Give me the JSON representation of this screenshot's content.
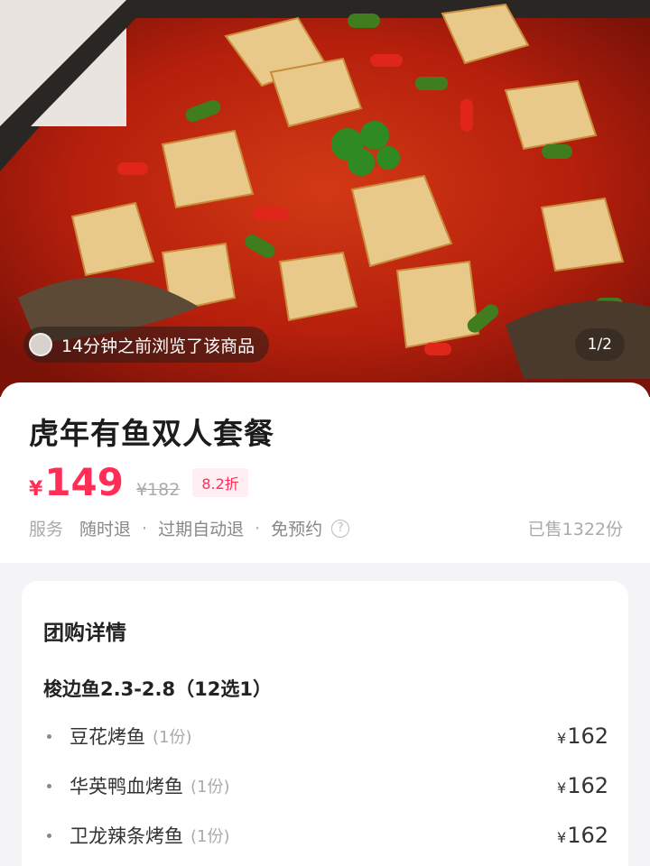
{
  "hero": {
    "image_alt": "food-photo",
    "viewed_text": "14分钟之前浏览了该商品",
    "pager": "1/2"
  },
  "product": {
    "title": "虎年有鱼双人套餐",
    "currency": "¥",
    "price": "149",
    "original_price": "¥182",
    "discount": "8.2折",
    "service_label": "服务",
    "services": [
      "随时退",
      "过期自动退",
      "免预约"
    ],
    "separator": "·",
    "help_icon": "?",
    "sold": "已售1322份"
  },
  "details": {
    "title": "团购详情",
    "group_title": "梭边鱼2.3-2.8（12选1）",
    "items": [
      {
        "name": "豆花烤鱼",
        "qty": "(1份)",
        "currency": "¥",
        "price": "162"
      },
      {
        "name": "华英鸭血烤鱼",
        "qty": "(1份)",
        "currency": "¥",
        "price": "162"
      },
      {
        "name": "卫龙辣条烤鱼",
        "qty": "(1份)",
        "currency": "¥",
        "price": "162"
      }
    ]
  },
  "colors": {
    "accent": "#ff2e56",
    "discount_bg": "#ffeef2",
    "page_bg": "#f4f4f6"
  }
}
